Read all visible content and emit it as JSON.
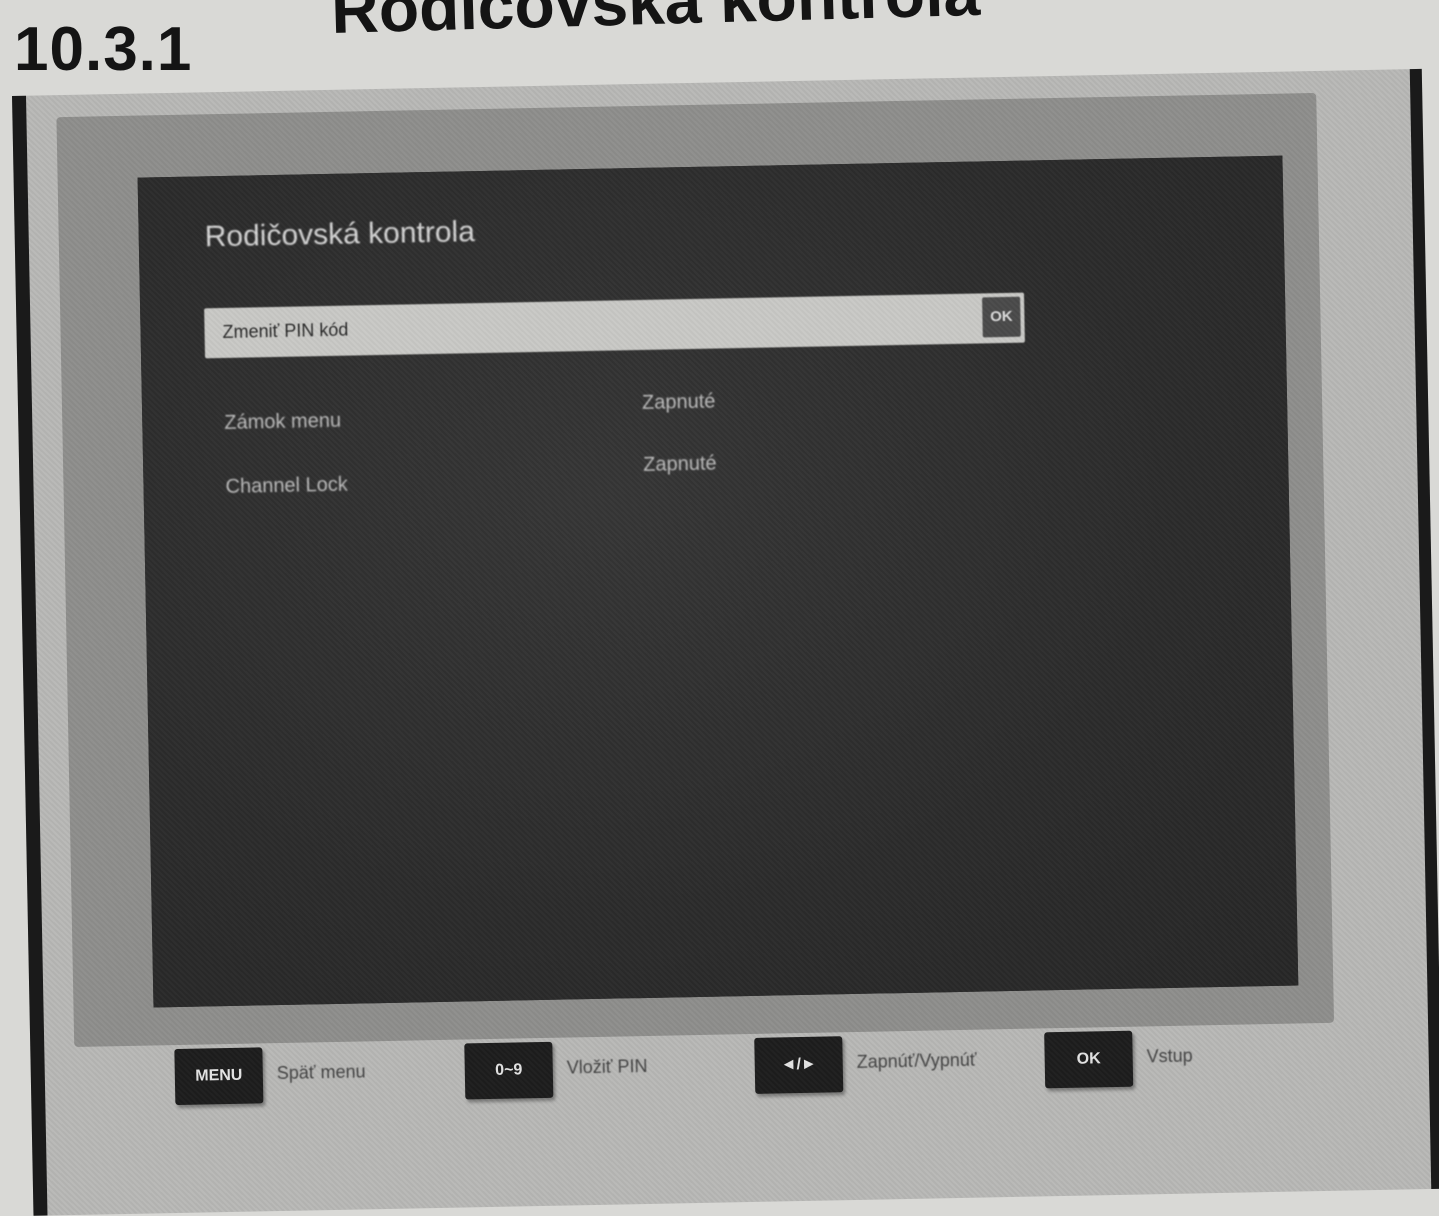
{
  "heading": {
    "number": "10.3.1",
    "title": "Rodičovská kontrola"
  },
  "menu": {
    "title": "Rodičovská kontrola",
    "selected_item": {
      "label": "Zmeniť PIN kód",
      "badge": "OK"
    },
    "items": [
      {
        "label": "Zámok menu",
        "value": "Zapnuté"
      },
      {
        "label": "Channel Lock",
        "value": "Zapnuté"
      }
    ]
  },
  "hints": [
    {
      "key": "MENU",
      "text": "Späť menu"
    },
    {
      "key": "0~9",
      "text": "Vložiť PIN"
    },
    {
      "key": "◄/►",
      "text": "Zapnúť/Vypnúť"
    },
    {
      "key": "OK",
      "text": "Vstup"
    }
  ],
  "colors": {
    "page_background": "#d9d9d6",
    "screen_background": "#2e2e2e",
    "highlight_bar": "#c9c9c6",
    "key_background": "#1d1d1d"
  }
}
